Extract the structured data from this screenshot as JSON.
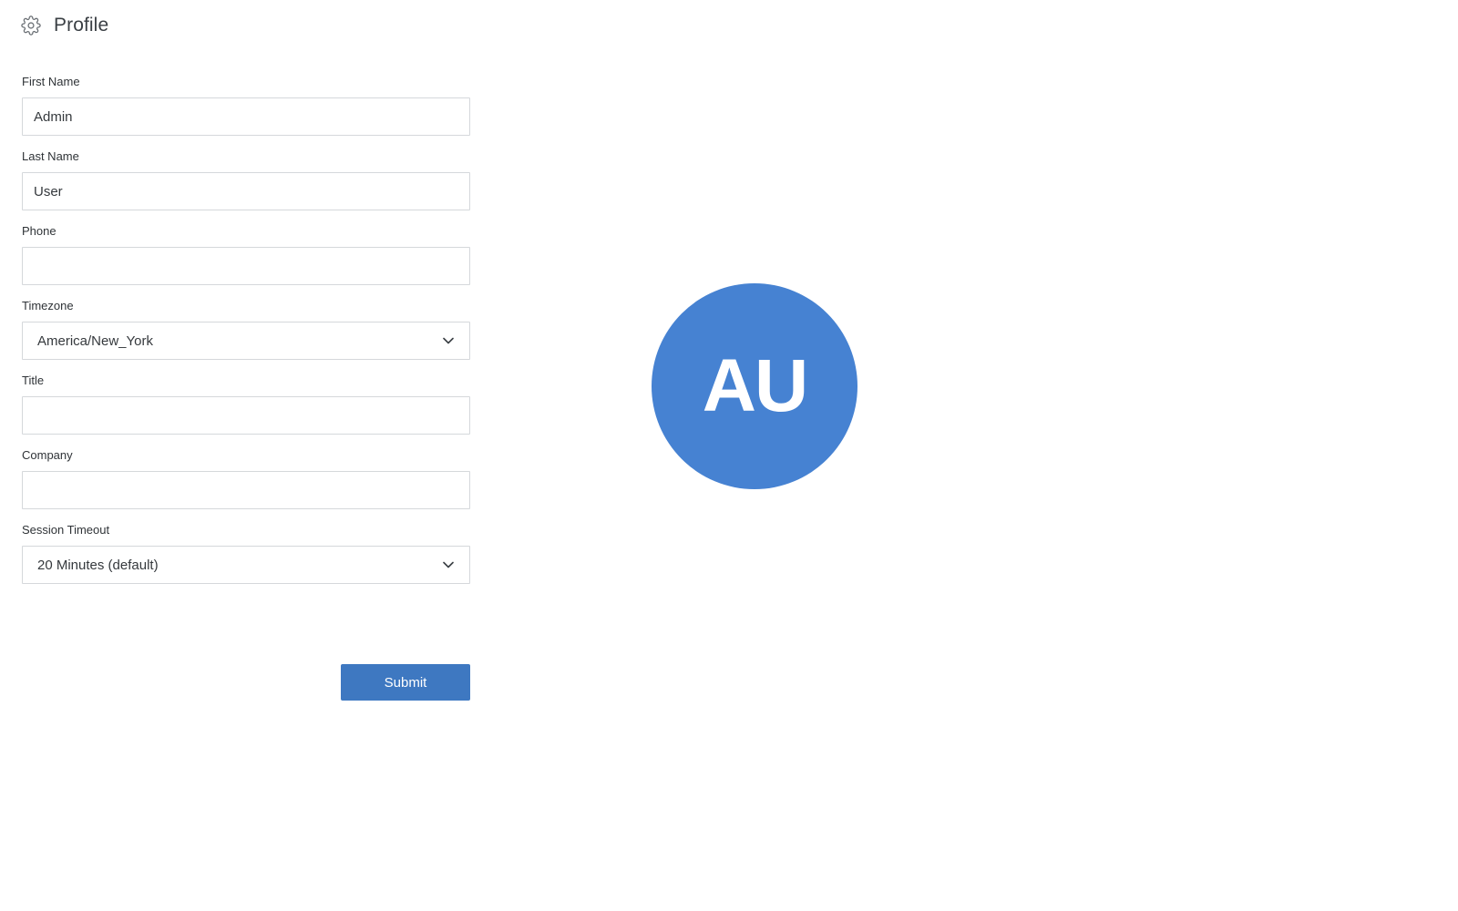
{
  "header": {
    "title": "Profile",
    "icon": "gear-icon"
  },
  "form": {
    "first_name": {
      "label": "First Name",
      "value": "Admin"
    },
    "last_name": {
      "label": "Last Name",
      "value": "User"
    },
    "phone": {
      "label": "Phone",
      "value": ""
    },
    "timezone": {
      "label": "Timezone",
      "value": "America/New_York"
    },
    "title": {
      "label": "Title",
      "value": ""
    },
    "company": {
      "label": "Company",
      "value": ""
    },
    "session_timeout": {
      "label": "Session Timeout",
      "value": "20 Minutes (default)"
    },
    "submit_label": "Submit"
  },
  "avatar": {
    "initials": "AU",
    "color": "#4682d2"
  },
  "colors": {
    "accent": "#3e78c1",
    "border": "#d5d8db"
  }
}
